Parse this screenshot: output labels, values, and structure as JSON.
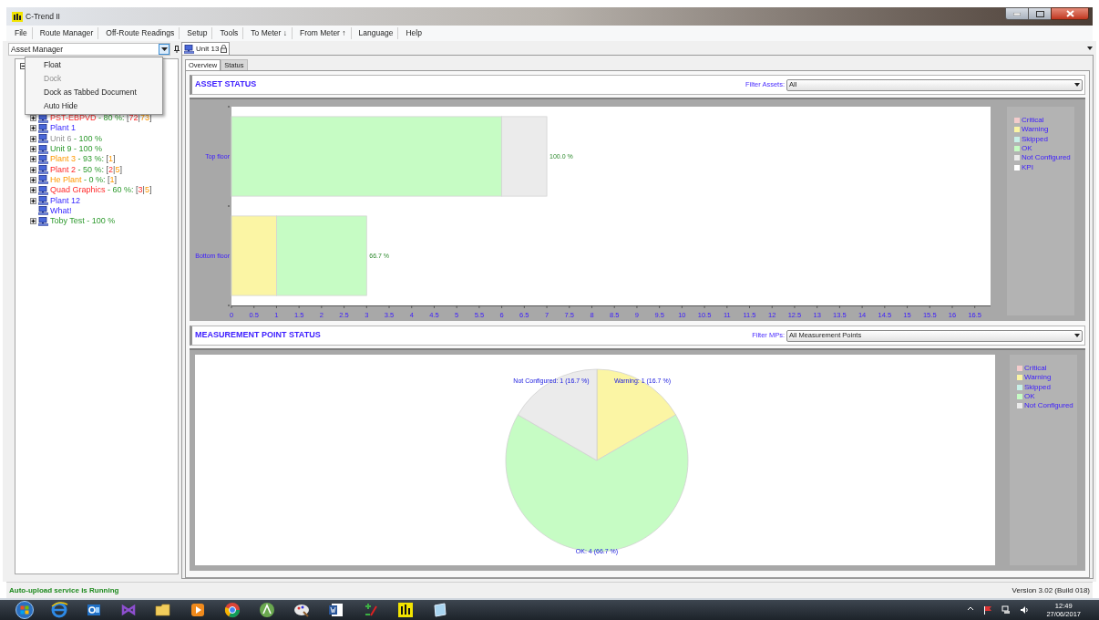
{
  "window": {
    "title": "C-Trend II"
  },
  "menu": [
    "File",
    "Route Manager",
    "Off-Route Readings",
    "Setup",
    "Tools",
    "To Meter ↓",
    "From Meter ↑",
    "Language",
    "Help"
  ],
  "asset_manager": {
    "title": "Asset Manager",
    "tree": {
      "expanded": true,
      "children": [
        {
          "kind": "node",
          "expanded": false,
          "parts": [
            {
              "text": "PST-EBPVD",
              "kind": "critical"
            },
            {
              "text": " - 80 %: ",
              "kind": "ok"
            },
            {
              "text": "[",
              "kind": "neutral"
            },
            {
              "text": "72",
              "kind": "critical"
            },
            {
              "text": "|",
              "kind": "neutral"
            },
            {
              "text": "73",
              "kind": "warning"
            },
            {
              "text": "]",
              "kind": "neutral"
            }
          ]
        },
        {
          "kind": "node",
          "expanded": false,
          "parts": [
            {
              "text": "Plant 1",
              "kind": "plain"
            }
          ]
        },
        {
          "kind": "node",
          "expanded": false,
          "parts": [
            {
              "text": "Unit 6",
              "kind": "unconfigured"
            },
            {
              "text": " - 100 %",
              "kind": "ok"
            }
          ]
        },
        {
          "kind": "node",
          "expanded": false,
          "parts": [
            {
              "text": "Unit 9",
              "kind": "ok"
            },
            {
              "text": " - 100 %",
              "kind": "ok"
            }
          ]
        },
        {
          "kind": "node",
          "expanded": false,
          "parts": [
            {
              "text": "Plant 3",
              "kind": "warning"
            },
            {
              "text": " - 93 %: ",
              "kind": "ok"
            },
            {
              "text": "[",
              "kind": "neutral"
            },
            {
              "text": "1",
              "kind": "warning"
            },
            {
              "text": "]",
              "kind": "neutral"
            }
          ]
        },
        {
          "kind": "node",
          "expanded": false,
          "parts": [
            {
              "text": "Plant 2",
              "kind": "critical"
            },
            {
              "text": " - 50 %: ",
              "kind": "ok"
            },
            {
              "text": "[",
              "kind": "neutral"
            },
            {
              "text": "2",
              "kind": "critical"
            },
            {
              "text": "|",
              "kind": "neutral"
            },
            {
              "text": "5",
              "kind": "warning"
            },
            {
              "text": "]",
              "kind": "neutral"
            }
          ]
        },
        {
          "kind": "node",
          "expanded": false,
          "parts": [
            {
              "text": "He Plant",
              "kind": "warning"
            },
            {
              "text": " - 0 %: ",
              "kind": "ok"
            },
            {
              "text": "[",
              "kind": "neutral"
            },
            {
              "text": "1",
              "kind": "warning"
            },
            {
              "text": "]",
              "kind": "neutral"
            }
          ]
        },
        {
          "kind": "node",
          "expanded": false,
          "parts": [
            {
              "text": "Quad Graphics",
              "kind": "critical"
            },
            {
              "text": " - 60 %: ",
              "kind": "ok"
            },
            {
              "text": "[",
              "kind": "neutral"
            },
            {
              "text": "3",
              "kind": "critical"
            },
            {
              "text": "|",
              "kind": "neutral"
            },
            {
              "text": "5",
              "kind": "warning"
            },
            {
              "text": "]",
              "kind": "neutral"
            }
          ]
        },
        {
          "kind": "node",
          "expanded": false,
          "parts": [
            {
              "text": "Plant 12",
              "kind": "plain"
            }
          ]
        },
        {
          "kind": "leaf",
          "parts": [
            {
              "text": "What!",
              "kind": "plain"
            }
          ]
        },
        {
          "kind": "node",
          "expanded": false,
          "parts": [
            {
              "text": "Toby Test",
              "kind": "ok"
            },
            {
              "text": " - 100 %",
              "kind": "ok"
            }
          ]
        }
      ]
    },
    "context_menu": [
      {
        "label": "Float",
        "disabled": false
      },
      {
        "label": "Dock",
        "disabled": true
      },
      {
        "label": "Dock as Tabbed Document",
        "disabled": false
      },
      {
        "label": "Auto Hide",
        "disabled": false
      }
    ]
  },
  "document_tabs": [
    {
      "label": "Unit 13",
      "selected": true
    }
  ],
  "view_tabs": [
    {
      "label": "Overview",
      "selected": true
    },
    {
      "label": "Status",
      "selected": false
    }
  ],
  "asset_status": {
    "title": "ASSET STATUS",
    "filter": {
      "label": "Filter Assets:",
      "value": "All"
    },
    "chart_data": {
      "type": "bar",
      "orientation": "horizontal",
      "stacked": true,
      "categories": [
        "Top floor",
        "Bottom floor"
      ],
      "series": [
        {
          "name": "Critical",
          "color": "#f4cccc",
          "values": [
            0,
            0
          ]
        },
        {
          "name": "Warning",
          "color": "#fbf5a4",
          "values": [
            0,
            1
          ]
        },
        {
          "name": "Skipped",
          "color": "#c8f0e8",
          "values": [
            0,
            0
          ]
        },
        {
          "name": "OK",
          "color": "#c6fcc4",
          "values": [
            6,
            2
          ]
        },
        {
          "name": "Not Configured",
          "color": "#ebebeb",
          "values": [
            1,
            0
          ]
        },
        {
          "name": "KPI",
          "color": "#ffffff",
          "values": [
            0,
            0
          ]
        }
      ],
      "xlim": [
        0,
        16.85
      ],
      "xticks": [
        0,
        0.5,
        1,
        1.5,
        2,
        2.5,
        3,
        3.5,
        4,
        4.5,
        5,
        5.5,
        6,
        6.5,
        7,
        7.5,
        8,
        8.5,
        9,
        9.5,
        10,
        10.5,
        11,
        11.5,
        12,
        12.5,
        13,
        13.5,
        14,
        14.5,
        15,
        15.5,
        16,
        16.5
      ],
      "value_labels": [
        "100.0 %",
        "66.7 %"
      ]
    }
  },
  "measurement_point_status": {
    "title": "MEASUREMENT POINT STATUS",
    "filter": {
      "label": "Filter MPs:",
      "value": "All Measurement Points"
    },
    "legend": [
      {
        "color": "#f4cccc"
      },
      {
        "color": "#fbf5a4"
      },
      {
        "color": "#c8f0e8"
      },
      {
        "color": "#c6fcc4"
      },
      {
        "color": "#ebebeb"
      }
    ],
    "chart_data": {
      "type": "pie",
      "categories": [
        "Critical",
        "Warning",
        "Skipped",
        "OK",
        "Not Configured"
      ],
      "values": [
        0,
        1,
        0,
        4,
        1
      ],
      "value_labels": [
        null,
        "Warning: 1 (16.7 %)",
        null,
        "OK: 4 (66.7 %)",
        "Not Configured: 1 (16.7 %)"
      ]
    }
  },
  "status_bar": {
    "service": "Auto-upload service is Running",
    "version": "Version 3.02 (Build 018)"
  },
  "taskbar": {
    "time": "12:49",
    "date": "27/06/2017"
  }
}
